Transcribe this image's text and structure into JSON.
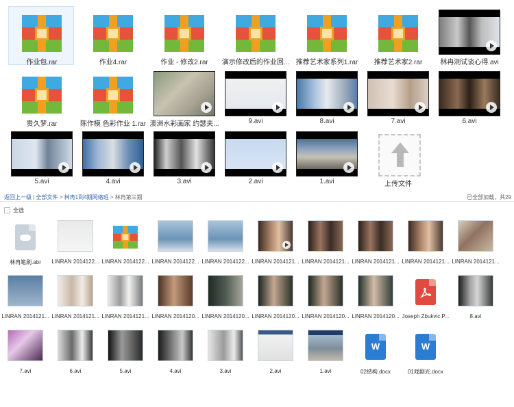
{
  "top_grid": {
    "row1": [
      {
        "type": "rar",
        "label": "作业包.rar"
      },
      {
        "type": "rar",
        "label": "作业4.rar"
      },
      {
        "type": "rar",
        "label": "作业 - 修改2.rar"
      },
      {
        "type": "rar",
        "label": "演示修改后的作业回..."
      },
      {
        "type": "rar",
        "label": "推荐艺术家系列1.rar"
      },
      {
        "type": "rar",
        "label": "推荐艺术家2.rar"
      },
      {
        "type": "video",
        "label": "林冉测试谈心得.avi"
      }
    ],
    "row2": [
      {
        "type": "rar",
        "label": "贵久梦.rar"
      },
      {
        "type": "rar",
        "label": "陈作模 色彩作业 1.rar"
      },
      {
        "type": "video",
        "label": "澳洲水彩画家 约瑟夫..."
      },
      {
        "type": "video",
        "label": "9.avi"
      },
      {
        "type": "video",
        "label": "8.avi"
      },
      {
        "type": "video",
        "label": "7.avi"
      },
      {
        "type": "video",
        "label": "6.avi"
      }
    ],
    "row3": [
      {
        "type": "video",
        "label": "5.avi"
      },
      {
        "type": "video",
        "label": "4.avi"
      },
      {
        "type": "video",
        "label": "3.avi"
      },
      {
        "type": "video",
        "label": "2.avi"
      },
      {
        "type": "video",
        "label": "1.avi"
      },
      {
        "type": "upload",
        "label": "上传文件"
      }
    ]
  },
  "breadcrumb": {
    "back": "返回上一级",
    "sep1": " | ",
    "all": "全部文件",
    "sep2": " > ",
    "folder1": "林冉1到4期网络班",
    "sep3": " > ",
    "folder2": "林冉第三期"
  },
  "status": {
    "loaded": "已全部加载，共29"
  },
  "select_all": {
    "label": "全选"
  },
  "bottom_grid": {
    "row1": [
      {
        "type": "cloud",
        "label": "林冉笔刷.abr"
      },
      {
        "type": "video",
        "label": "LINRAN 2014122..."
      },
      {
        "type": "rar",
        "label": "LINRAN 2014122..."
      },
      {
        "type": "video",
        "label": "LINRAN 2014122..."
      },
      {
        "type": "video",
        "label": "LINRAN 2014122..."
      },
      {
        "type": "video",
        "label": "LINRAN 2014121..."
      },
      {
        "type": "video",
        "label": "LINRAN 2014121..."
      },
      {
        "type": "video",
        "label": "LINRAN 2014121..."
      },
      {
        "type": "video",
        "label": "LINRAN 2014121..."
      },
      {
        "type": "video",
        "label": "LINRAN 2014121..."
      }
    ],
    "row2": [
      {
        "type": "video",
        "label": "LINRAN 2014121..."
      },
      {
        "type": "video",
        "label": "LINRAN 2014121..."
      },
      {
        "type": "video",
        "label": "LINRAN 2014121..."
      },
      {
        "type": "video",
        "label": "LINRAN 2014120..."
      },
      {
        "type": "video",
        "label": "LINRAN 2014120..."
      },
      {
        "type": "video",
        "label": "LINRAN 2014120..."
      },
      {
        "type": "video",
        "label": "LINRAN 2014120..."
      },
      {
        "type": "video",
        "label": "LINRAN 2014120..."
      },
      {
        "type": "pdf",
        "label": "Joseph Zbukvic.P..."
      },
      {
        "type": "video",
        "label": "8.avi"
      }
    ],
    "row3": [
      {
        "type": "video",
        "label": "7.avi"
      },
      {
        "type": "video",
        "label": "6.avi"
      },
      {
        "type": "video",
        "label": "5.avi"
      },
      {
        "type": "video",
        "label": "4.avi"
      },
      {
        "type": "video",
        "label": "3.avi"
      },
      {
        "type": "video",
        "label": "2.avi"
      },
      {
        "type": "video",
        "label": "1.avi"
      },
      {
        "type": "word",
        "label": "02结构.docx"
      },
      {
        "type": "word",
        "label": "01戏剧光.docx"
      }
    ]
  },
  "icons": {
    "play": "play-icon",
    "word_letter": "W",
    "upload": "upload-arrow-icon",
    "pdf": "pdf-icon",
    "cloud": "cloud-file-icon"
  },
  "colors": {
    "rar_blue": "#3fa9e0",
    "rar_red": "#e5533d",
    "rar_green": "#74b83b",
    "rar_belt": "#f0a020",
    "link": "#3366aa",
    "word": "#2b7cd3",
    "pdf": "#e04a3f"
  }
}
